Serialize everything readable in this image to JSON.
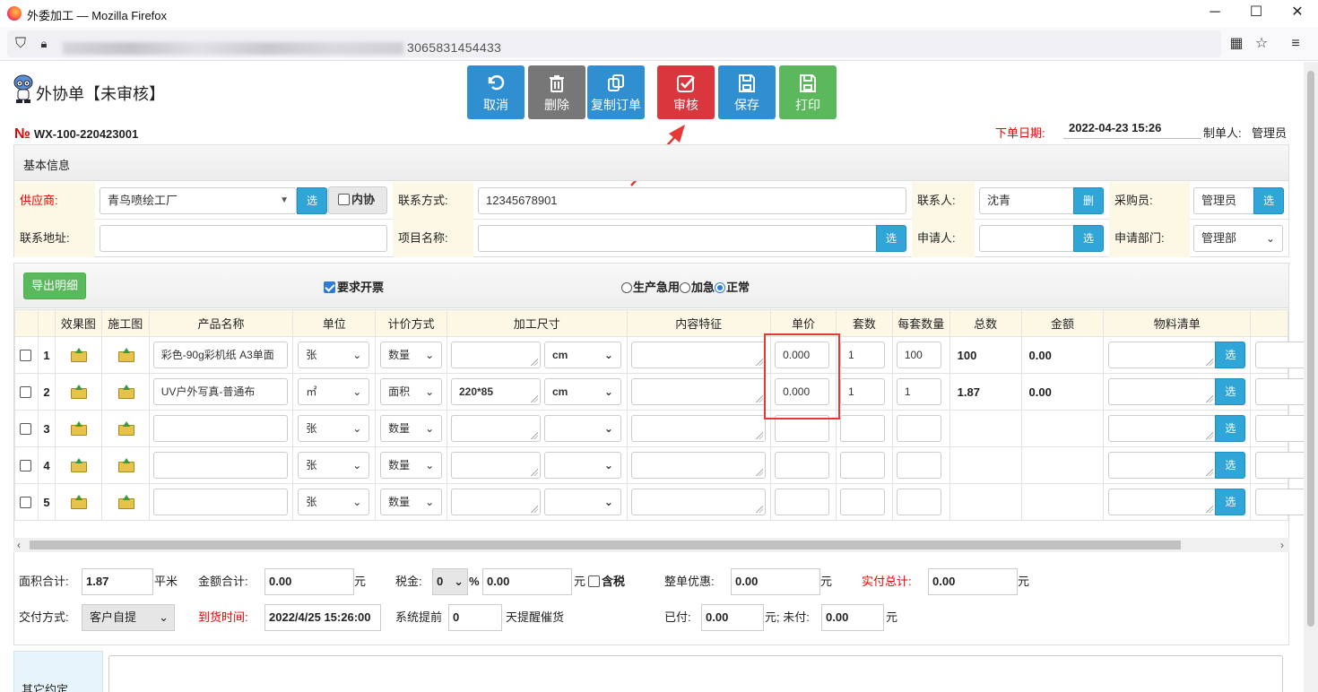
{
  "browser": {
    "title": "外委加工 — Mozilla Firefox",
    "url_suffix": "3065831454433"
  },
  "page": {
    "title": "外协单【未审核】",
    "order_no_symbol": "№",
    "order_no": "WX-100-220423001",
    "order_date_label": "下单日期:",
    "order_date": "2022-04-23 15:26",
    "creator_label": "制单人:",
    "creator": "管理员"
  },
  "toolbar": {
    "cancel": "取消",
    "delete": "删除",
    "copy": "复制订单",
    "approve": "审核",
    "save": "保存",
    "print": "打印"
  },
  "basic": {
    "section_title": "基本信息",
    "supplier_label": "供应商:",
    "supplier": "青鸟喷绘工厂",
    "select": "选",
    "internal_label": "内协",
    "contact_method_label": "联系方式:",
    "contact_method": "12345678901",
    "contact_person_label": "联系人:",
    "contact_person": "沈青",
    "delete_short": "删",
    "buyer_label": "采购员:",
    "buyer": "管理员",
    "address_label": "联系地址:",
    "project_label": "项目名称:",
    "applicant_label": "申请人:",
    "dept_label": "申请部门:",
    "dept": "管理部"
  },
  "detail": {
    "export": "导出明细",
    "invoice_label": "要求开票",
    "priority_options": [
      "生产急用",
      "加急",
      "正常"
    ],
    "priority_selected": "正常",
    "invoice_checked": true
  },
  "columns": [
    "效果图",
    "施工图",
    "产品名称",
    "单位",
    "计价方式",
    "加工尺寸",
    "内容特征",
    "单价",
    "套数",
    "每套数量",
    "总数",
    "金额",
    "物料清单"
  ],
  "rows": [
    {
      "n": "1",
      "name": "彩色-90g彩机纸 A3单面",
      "unit": "张",
      "pricing": "数量",
      "size": "",
      "size_unit": "cm",
      "price": "0.000",
      "sets": "1",
      "per_set": "100",
      "total": "100",
      "amount": "0.00"
    },
    {
      "n": "2",
      "name": "UV户外写真-普通布",
      "unit": "㎡",
      "pricing": "面积",
      "size": "220*85",
      "size_unit": "cm",
      "price": "0.000",
      "sets": "1",
      "per_set": "1",
      "total": "1.87",
      "amount": "0.00"
    },
    {
      "n": "3",
      "name": "",
      "unit": "张",
      "pricing": "数量",
      "size": "",
      "size_unit": "",
      "price": "",
      "sets": "",
      "per_set": "",
      "total": "",
      "amount": ""
    },
    {
      "n": "4",
      "name": "",
      "unit": "张",
      "pricing": "数量",
      "size": "",
      "size_unit": "",
      "price": "",
      "sets": "",
      "per_set": "",
      "total": "",
      "amount": ""
    },
    {
      "n": "5",
      "name": "",
      "unit": "张",
      "pricing": "数量",
      "size": "",
      "size_unit": "",
      "price": "",
      "sets": "",
      "per_set": "",
      "total": "",
      "amount": ""
    }
  ],
  "footer": {
    "area_label": "面积合计:",
    "area": "1.87",
    "area_unit": "平米",
    "amount_label": "金额合计:",
    "amount": "0.00",
    "yuan": "元",
    "tax_label": "税金:",
    "tax_rate": "0",
    "percent": "%",
    "tax": "0.00",
    "tax_incl": "含税",
    "discount_label": "整单优惠:",
    "discount": "0.00",
    "actual_label": "实付总计:",
    "actual": "0.00",
    "delivery_label": "交付方式:",
    "delivery": "客户自提",
    "arrival_label": "到货时间:",
    "arrival": "2022/4/25 15:26:00",
    "remind_pre": "系统提前",
    "remind_days": "0",
    "remind_post": "天提醒催货",
    "paid_label": "已付:",
    "paid": "0.00",
    "unpaid_label": "元; 未付:",
    "unpaid": "0.00",
    "other_label": "其它约定"
  }
}
